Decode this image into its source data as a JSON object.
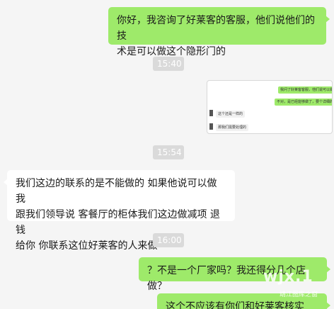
{
  "messages": {
    "m1": "你好，我咨询了好莱客的客服，他们说他们的技\n术是可以做这个隐形门的",
    "m2": "我们这边的联系的是不能做的 如果他说可以做 我\n跟我们领导说 客餐厅的柜体我们这边做减项 退钱\n给你 你联系这位好莱客的人来做",
    "m3": "？不是一个厂家吗？我还得分几个店做？",
    "m4": "这个不应该有你们和好莱客核实吗？"
  },
  "timestamps": {
    "t1": "15:40",
    "t2": "15:54",
    "t3": "16:00"
  },
  "image_message": {
    "line1": "我问了好莱客客服，他们说可以做",
    "line2": "不对，是已经能够做了，要个详细的",
    "line3": "这个还是一样的",
    "line4": "那我们需要处理的"
  },
  "watermark": {
    "text": "wjx.1",
    "subtitle": "靖江图库之窗"
  },
  "colors": {
    "background": "#f5f5f5",
    "sent_bubble": "#9eea6a",
    "received_bubble": "#ffffff",
    "timestamp_bg": "#dadada"
  }
}
